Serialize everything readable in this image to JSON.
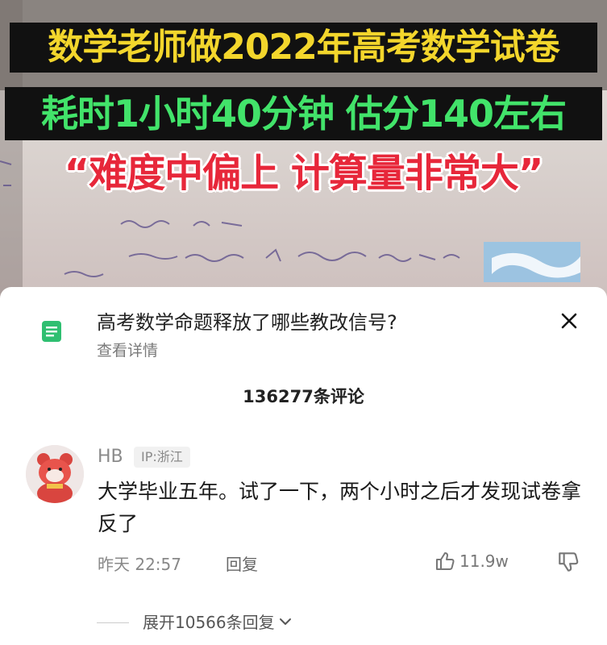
{
  "video": {
    "caption_line1": "数学老师做2022年高考数学试卷",
    "caption_line2": "耗时1小时40分钟 估分140左右",
    "caption_line3": "“难度中偏上 计算量非常大”",
    "colors": {
      "line1": "#f3d62c",
      "line2": "#42e36a",
      "line3": "#e7273a"
    }
  },
  "topic": {
    "icon": "document-icon",
    "title": "高考数学命题释放了哪些教改信号?",
    "subtitle": "查看详情",
    "accent": "#2fbf71"
  },
  "close_icon": "close-icon",
  "comment_count": "136277条评论",
  "comment": {
    "avatar": "plush-bear-avatar",
    "username": "HB",
    "ip": "IP:浙江",
    "text": "大学毕业五年。试了一下，两个小时之后才发现试卷拿反了",
    "time": "昨天 22:57",
    "reply_label": "回复",
    "likes": "11.9w",
    "like_icon": "thumbs-up-icon",
    "dislike_icon": "thumbs-down-icon"
  },
  "expand_replies": "展开10566条回复"
}
